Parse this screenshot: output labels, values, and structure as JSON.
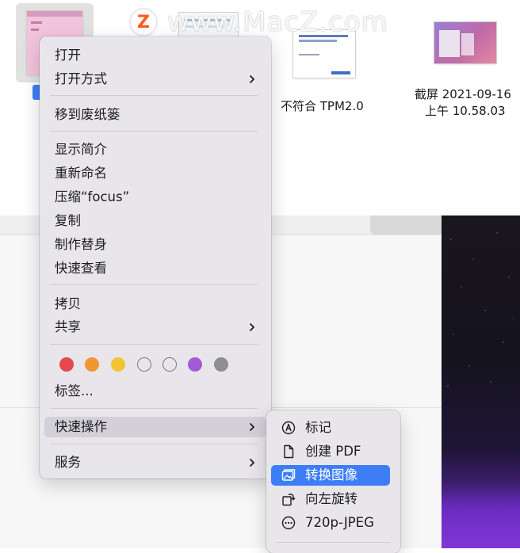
{
  "watermark": {
    "logo": "Z",
    "text": "www.MacZ.com"
  },
  "desktop_files": [
    {
      "label": ""
    },
    {
      "label": ""
    },
    {
      "label": "不符合 TPM2.0"
    },
    {
      "label_line1": "截屏 2021-09-16",
      "label_line2": "上午 10.58.03"
    }
  ],
  "context_menu": {
    "open": "打开",
    "open_with": "打开方式",
    "move_to_trash": "移到废纸篓",
    "get_info": "显示简介",
    "rename": "重新命名",
    "compress": "压缩“focus”",
    "duplicate": "复制",
    "make_alias": "制作替身",
    "quick_look": "快速查看",
    "copy": "拷贝",
    "share": "共享",
    "tags_label": "标签...",
    "quick_actions": "快速操作",
    "services": "服务",
    "tag_colors": [
      "#e5484d",
      "#f0972f",
      "#f4c430",
      "#ffffff",
      "#ffffff",
      "#a45ad6",
      "#8e8e93"
    ]
  },
  "quick_actions_submenu": {
    "markup": "标记",
    "create_pdf": "创建 PDF",
    "convert_image": "转换图像",
    "rotate_left": "向左旋转",
    "preset_720p": "720p-JPEG"
  },
  "colors": {
    "accent": "#3d7ef7",
    "menu_bg": "#e8e5eb",
    "highlight": "#d3d0d8"
  }
}
